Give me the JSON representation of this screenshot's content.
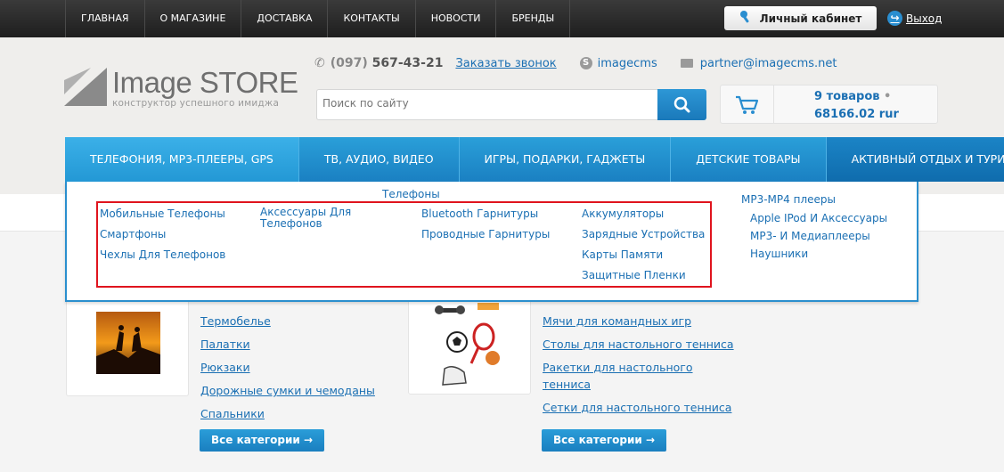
{
  "topnav": [
    "ГЛАВНАЯ",
    "О МАГАЗИНЕ",
    "ДОСТАВКА",
    "КОНТАКТЫ",
    "НОВОСТИ",
    "БРЕНДЫ"
  ],
  "account": {
    "cabinet_label": "Личный кабинет",
    "exit_label": "Выход"
  },
  "logo": {
    "title": "Image STORE",
    "subtitle": "конструктор успешного имиджа"
  },
  "contacts": {
    "phone_prefix": "(097)",
    "phone_number": "567-43-21",
    "callback": "Заказать звонок",
    "skype": "imagecms",
    "email": "partner@imagecms.net"
  },
  "search": {
    "placeholder": "Поиск по сайту"
  },
  "cart": {
    "items": "9 товаров",
    "dot": "•",
    "total": "68166.02 rur"
  },
  "mainnav": [
    "ТЕЛЕФОНИЯ, МР3-ПЛЕЕРЫ, GPS",
    "ТВ, АУДИО, ВИДЕО",
    "ИГРЫ, ПОДАРКИ, ГАДЖЕТЫ",
    "ДЕТСКИЕ ТОВАРЫ",
    "АКТИВНЫЙ ОТДЫХ И ТУРИЗМ"
  ],
  "dropdown": {
    "title": "Телефоны",
    "col1": [
      "Мобильные Телефоны",
      "Смартфоны",
      "Чехлы Для Телефонов"
    ],
    "col2_line1": "Аксессуары Для",
    "col2_line2": "Телефонов",
    "col3": [
      "Bluetooth Гарнитуры",
      "Проводные Гарнитуры"
    ],
    "col4": [
      "Аккумуляторы",
      "Зарядные Устройства",
      "Карты Памяти",
      "Защитные Пленки"
    ],
    "mp3_title": "MP3-MP4 плееры",
    "mp3": [
      "Apple IPod И Аксессуары",
      "MP3- И Медиаплееры",
      "Наушники"
    ]
  },
  "section1": {
    "links": [
      "Термобелье",
      "Палатки",
      "Рюкзаки",
      "Дорожные сумки и чемоданы",
      "Спальники"
    ],
    "button": "Все категории →"
  },
  "section2": {
    "links": [
      "Мячи для командных игр",
      "Столы для настольного тенниса",
      "Ракетки для настольного",
      "тенниса",
      "Сетки для настольного тенниса"
    ],
    "button": "Все категории →"
  },
  "colors": {
    "accent": "#1a80c2",
    "link": "#1a6fb3",
    "highlight": "#e0141e"
  }
}
